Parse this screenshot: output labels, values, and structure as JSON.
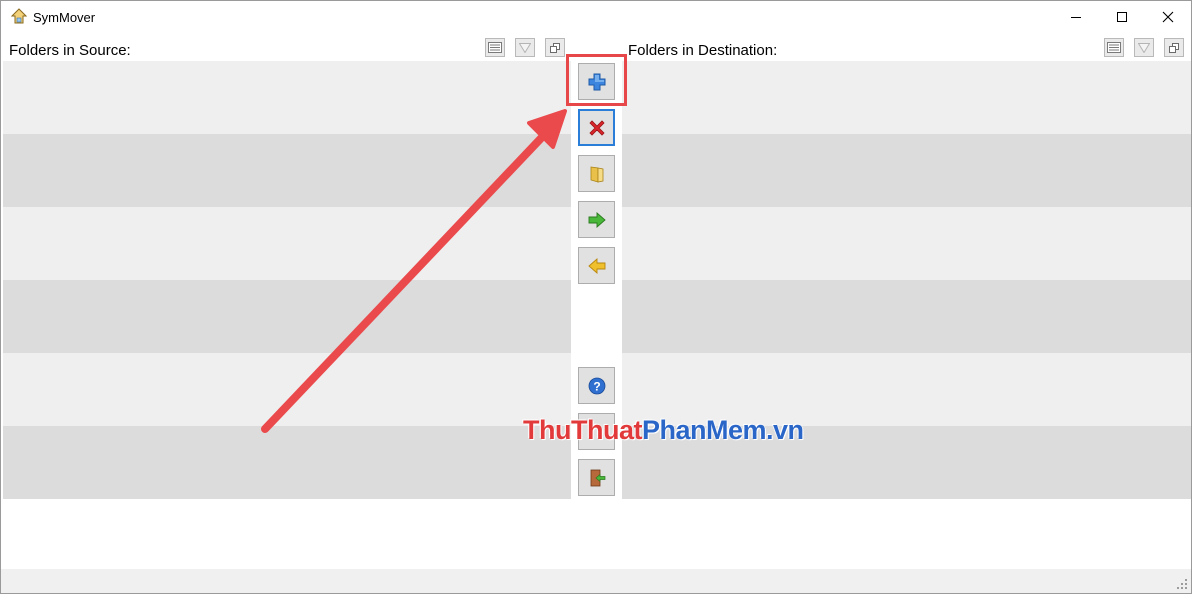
{
  "window": {
    "title": "SymMover"
  },
  "panes": {
    "source": {
      "label": "Folders in Source:"
    },
    "destination": {
      "label": "Folders in Destination:"
    }
  },
  "watermark": {
    "part1": "ThuThuat",
    "part2": "PhanMem",
    "part3": ".vn"
  },
  "icons": {
    "app": "symmover-app-icon",
    "minimize": "minimize-icon",
    "maximize": "maximize-icon",
    "close": "close-icon",
    "list_view": "list-view-icon",
    "filter": "filter-icon",
    "restore_window": "restore-window-icon",
    "add": "plus-icon",
    "remove": "red-x-icon",
    "folder": "folder-icon",
    "move_right": "green-arrow-right-icon",
    "move_left": "yellow-arrow-left-icon",
    "help": "help-icon",
    "exit": "exit-door-icon"
  },
  "colors": {
    "highlight": "#e8474a",
    "row_light": "#efefef",
    "row_dark": "#dcdcdc",
    "watermark_red": "#e23a3a",
    "watermark_blue": "#2a66c8"
  }
}
